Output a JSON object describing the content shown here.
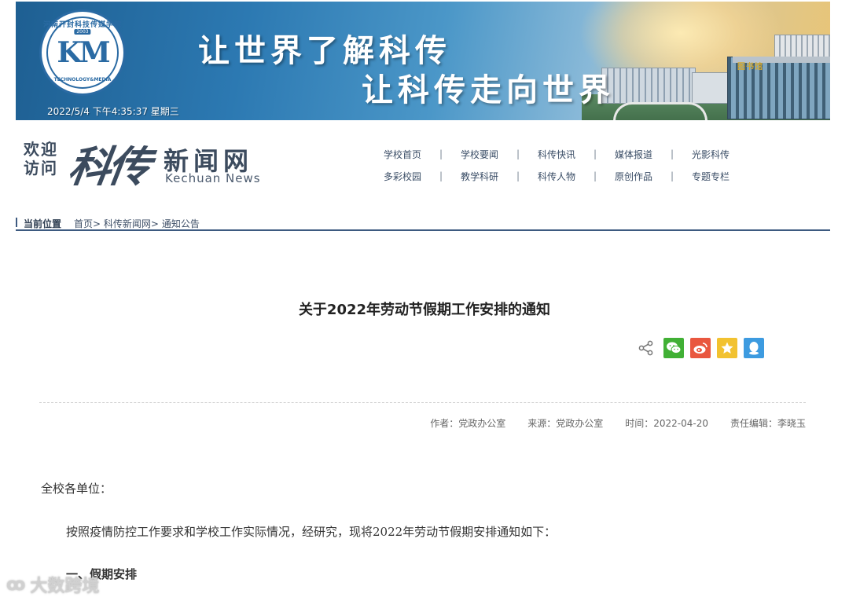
{
  "banner": {
    "slogan_1": "让世界了解科传",
    "slogan_2": "让科传走向世界",
    "clock": "2022/5/4 下午4:35:37 星期三",
    "logo_top": "河南开封科技传媒学院",
    "logo_bottom": "TECHNOLOGY&MEDIA",
    "logo_year": "2003",
    "building_sign": "图书馆"
  },
  "header": {
    "welcome_line1": "欢迎",
    "welcome_line2": "访问",
    "brand_script": "科传",
    "brand_title": "新闻网",
    "brand_en": "Kechuan News"
  },
  "nav": {
    "row1": [
      "学校首页",
      "学校要闻",
      "科传快讯",
      "媒体报道",
      "光影科传"
    ],
    "row2": [
      "多彩校园",
      "教学科研",
      "科传人物",
      "原创作品",
      "专题专栏"
    ],
    "separator": "|"
  },
  "breadcrumb": {
    "label": "当前位置",
    "items": [
      "首页",
      "科传新闻网",
      "通知公告"
    ],
    "sep": ">"
  },
  "article": {
    "title": "关于2022年劳动节假期工作安排的通知",
    "meta": {
      "author": "作者：党政办公室",
      "source": "来源：党政办公室",
      "time": "时间：2022-04-20",
      "editor": "责任编辑：李晓玉"
    },
    "greeting": "全校各单位：",
    "intro": "按照疫情防控工作要求和学校工作实际情况，经研究，现将2022年劳动节假期安排通知如下：",
    "section1": "一、假期安排"
  },
  "share": {
    "icons": [
      "share-icon",
      "wechat-icon",
      "weibo-icon",
      "favorite-icon",
      "qq-icon"
    ]
  },
  "watermark": {
    "text": "大数跨境"
  },
  "colors": {
    "nav_text": "#3a4d66",
    "rule": "#3d5a80",
    "wechat": "#41b035",
    "weibo": "#e9573f",
    "favorite": "#f2c230",
    "qq": "#3d9be0"
  }
}
